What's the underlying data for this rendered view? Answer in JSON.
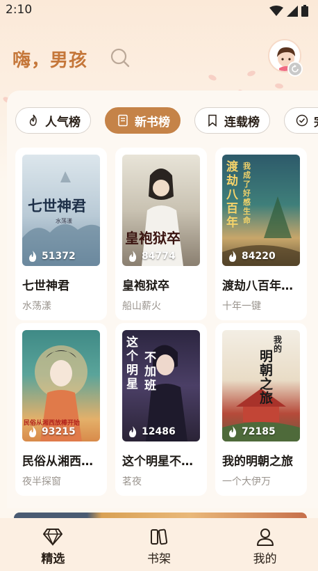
{
  "status": {
    "time": "2:10"
  },
  "header": {
    "greeting": "嗨，男孩"
  },
  "tabs": [
    {
      "label": "人气榜",
      "icon": "flame-icon",
      "active": false
    },
    {
      "label": "新书榜",
      "icon": "book-icon",
      "active": true
    },
    {
      "label": "连载榜",
      "icon": "bookmark-icon",
      "active": false
    },
    {
      "label": "完",
      "icon": "check-circle-icon",
      "active": false
    }
  ],
  "books": [
    {
      "title": "七世神君",
      "author": "水荡漾",
      "heat": "51372",
      "cover_text": "七世神君",
      "cover_sub": "水荡漾"
    },
    {
      "title": "皇袍狱卒",
      "author": "船山薪火",
      "heat": "84774",
      "cover_text": "皇袍狱卒"
    },
    {
      "title": "渡劫八百年…",
      "author": "十年一键",
      "heat": "84220",
      "cover_text": "渡劫八百年",
      "cover_sub": "我成了好感生命"
    },
    {
      "title": "民俗从湘西…",
      "author": "夜半探窗",
      "heat": "93215",
      "cover_text": "民俗从湘西放棒开始"
    },
    {
      "title": "这个明星不…",
      "author": "茗夜",
      "heat": "12486",
      "cover_text": "这个明星",
      "cover_sub": "不加班"
    },
    {
      "title": "我的明朝之旅",
      "author": "一个大伊万",
      "heat": "72185",
      "cover_text": "明朝之旅",
      "cover_sub": "我的"
    }
  ],
  "bottom_nav": [
    {
      "label": "精选",
      "icon": "diamond-icon",
      "active": true
    },
    {
      "label": "书架",
      "icon": "bookshelf-icon",
      "active": false
    },
    {
      "label": "我的",
      "icon": "user-icon",
      "active": false
    }
  ],
  "colors": {
    "accent": "#c58348",
    "greeting": "#c5773a"
  }
}
